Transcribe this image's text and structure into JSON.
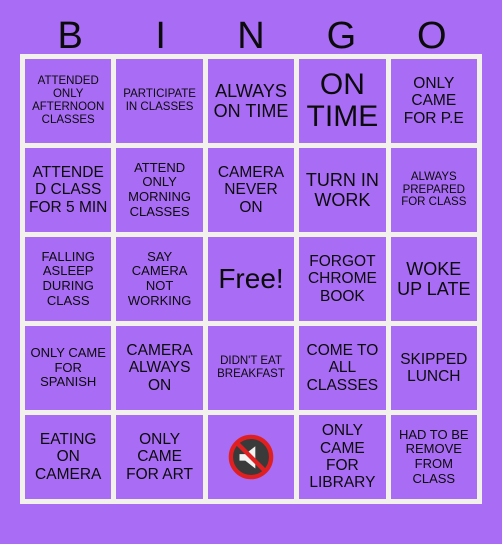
{
  "card": {
    "header_letters": [
      "B",
      "I",
      "N",
      "G",
      "O"
    ],
    "background_color": "#a96cf5",
    "grid_line_color": "#f3f1ec",
    "text_color": "#0b0b0b",
    "rows": 5,
    "columns": 5,
    "cells": [
      {
        "text": "ATTENDED ONLY AFTERNOON CLASSES",
        "size": "xs",
        "type": "text"
      },
      {
        "text": "PARTICIPATE IN CLASSES",
        "size": "xs",
        "type": "text"
      },
      {
        "text": "ALWAYS ON TIME",
        "size": "lg",
        "type": "text"
      },
      {
        "text": "ON TIME",
        "size": "xl",
        "type": "text"
      },
      {
        "text": "ONLY CAME FOR P.E",
        "size": "md",
        "type": "text"
      },
      {
        "text": "ATTENDED CLASS FOR 5 MIN",
        "size": "md",
        "type": "text"
      },
      {
        "text": "ATTEND ONLY MORNING CLASSES",
        "size": "sm",
        "type": "text"
      },
      {
        "text": "CAMERA NEVER ON",
        "size": "md",
        "type": "text"
      },
      {
        "text": "TURN IN WORK",
        "size": "lg",
        "type": "text"
      },
      {
        "text": "ALWAYS PREPARED FOR CLASS",
        "size": "xs",
        "type": "text"
      },
      {
        "text": "FALLING ASLEEP DURING CLASS",
        "size": "sm",
        "type": "text"
      },
      {
        "text": "SAY CAMERA NOT WORKING",
        "size": "sm",
        "type": "text"
      },
      {
        "text": "Free!",
        "size": "free",
        "type": "free"
      },
      {
        "text": "FORGOT CHROME BOOK",
        "size": "md",
        "type": "text"
      },
      {
        "text": "WOKE UP LATE",
        "size": "lg",
        "type": "text"
      },
      {
        "text": "ONLY CAME FOR SPANISH",
        "size": "sm",
        "type": "text"
      },
      {
        "text": "CAMERA ALWAYS ON",
        "size": "md",
        "type": "text"
      },
      {
        "text": "DIDN'T EAT BREAKFAST",
        "size": "xs",
        "type": "text"
      },
      {
        "text": "COME TO ALL CLASSES",
        "size": "md",
        "type": "text"
      },
      {
        "text": "SKIPPED LUNCH",
        "size": "md",
        "type": "text"
      },
      {
        "text": "EATING ON CAMERA",
        "size": "md",
        "type": "text"
      },
      {
        "text": "ONLY CAME FOR ART",
        "size": "md",
        "type": "text"
      },
      {
        "text": "",
        "size": "md",
        "type": "icon",
        "icon": "muted-speaker-icon"
      },
      {
        "text": "ONLY CAME FOR LIBRARY",
        "size": "md",
        "type": "text"
      },
      {
        "text": "HAD TO BE REMOVE FROM CLASS",
        "size": "sm",
        "type": "text"
      }
    ]
  }
}
